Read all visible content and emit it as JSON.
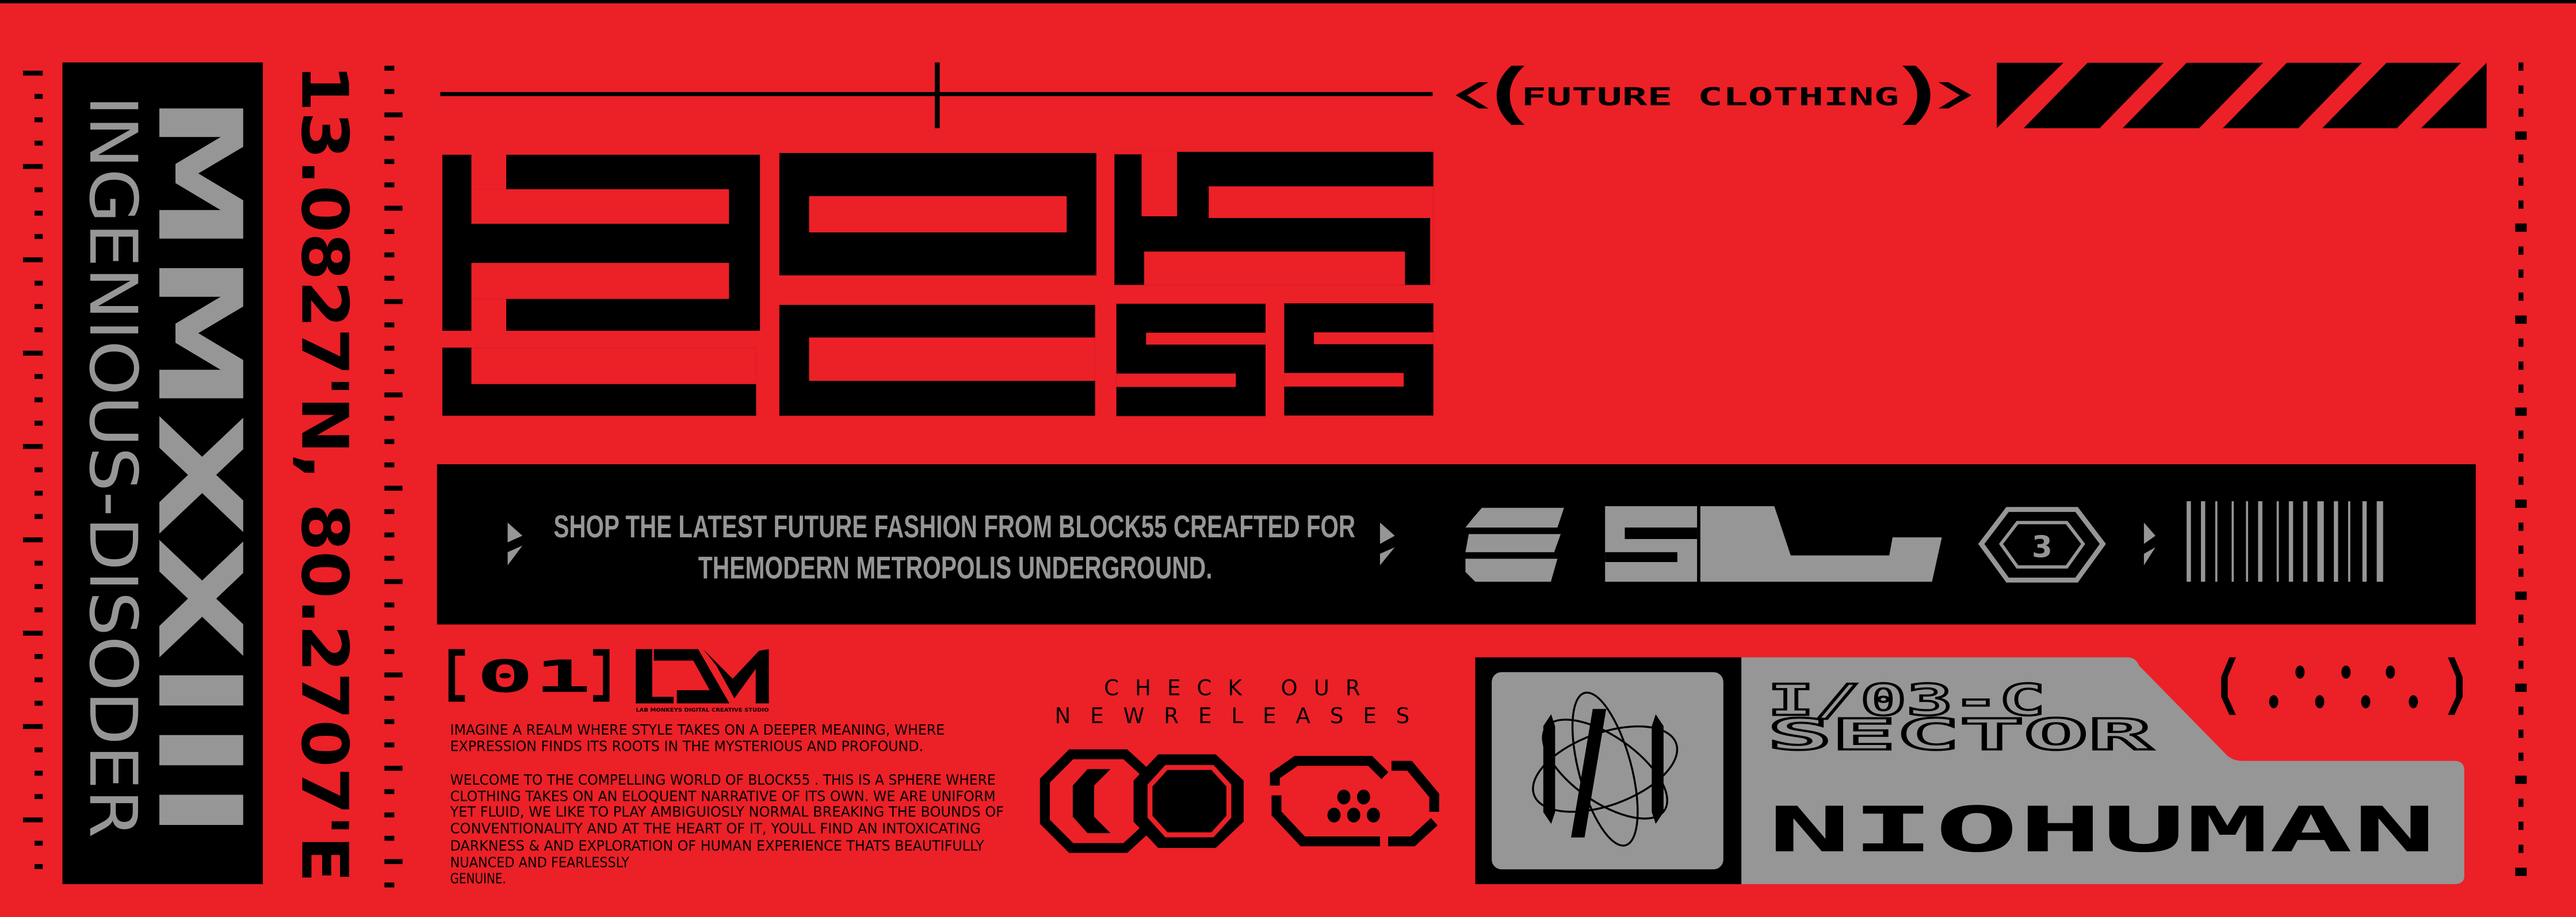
{
  "colors": {
    "background": "#ec2027",
    "ink": "#000000",
    "panel_gray": "#969696"
  },
  "side": {
    "roman_year": "MMXXIII",
    "tagline": "INGENIOUS-DISODER",
    "coordinates": "13.0827'N, 80.2707'E"
  },
  "header": {
    "logo": "BLOCK55",
    "badge": "FUTURE CLOTHING"
  },
  "banner": {
    "line1": "SHOP THE LATEST FUTURE FASHION FROM BLOCK55 CREAFTED FOR",
    "line2": "THEMODERN METROPOLIS UNDERGROUND.",
    "mark": "51",
    "hex_number": "3"
  },
  "studio": {
    "number": "01",
    "logo": "LDM",
    "logo_caption": "LAB MONKEYS DIGITAL CREATIVE STUDIO"
  },
  "about": {
    "lines": [
      "IMAGINE A REALM WHERE STYLE TAKES ON A DEEPER MEANING, WHERE",
      "EXPRESSION FINDS ITS ROOTS IN THE MYSTERIOUS AND PROFOUND.",
      "WELCOME TO THE COMPELLING WORLD OF BLOCK55 . THIS IS A SPHERE WHERE",
      "CLOTHING TAKES ON AN ELOQUENT NARRATIVE OF ITS OWN. WE ARE UNIFORM",
      "YET FLUID, WE LIKE TO PLAY AMBIGUIOSLY NORMAL BREAKING THE BOUNDS OF",
      "CONVENTIONALITY AND AT THE HEART OF IT, YOULL FIND AN INTOXICATING",
      "DARKNESS & AND EXPLORATION OF HUMAN EXPERIENCE THATS BEAUTIFULLY",
      "NUANCED AND FEARLESSLY",
      "GENUINE."
    ]
  },
  "cta": {
    "line1": "CHECK OUR",
    "line2": "NEWRELEASES"
  },
  "card": {
    "code": "I/03-C",
    "sector": "SECTOR",
    "name": "NIOHUMAN"
  }
}
